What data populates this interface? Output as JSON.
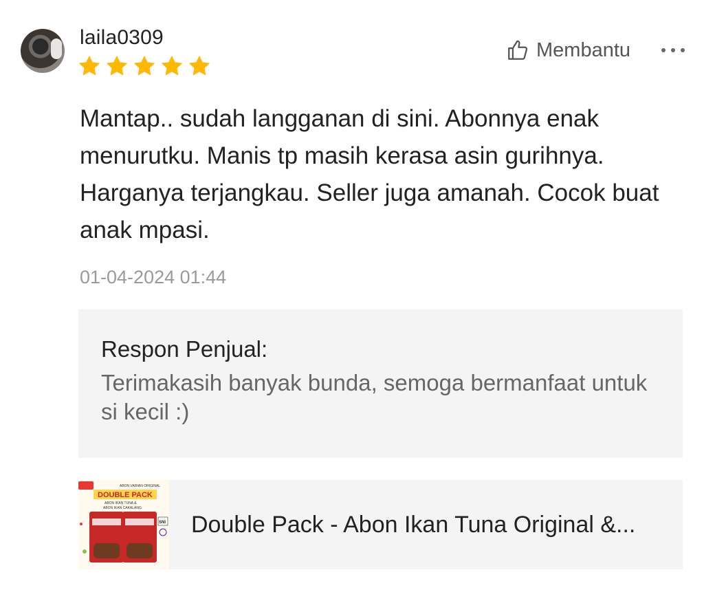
{
  "review": {
    "username": "laila0309",
    "rating": 5,
    "rating_max": 5,
    "text": "Mantap.. sudah langganan di sini. Abonnya enak menurutku. Manis tp masih kerasa asin gurihnya. Harganya terjangkau. Seller juga amanah. Cocok buat anak mpasi.",
    "timestamp": "01-04-2024 01:44"
  },
  "actions": {
    "helpful_label": "Membantu",
    "helpful_icon": "thumbs-up-icon",
    "more_icon": "more-horizontal-icon"
  },
  "seller_response": {
    "title": "Respon Penjual:",
    "text": "Terimakasih banyak bunda, semoga bermanfaat untuk si kecil :)"
  },
  "product": {
    "title": "Double Pack - Abon Ikan Tuna Original &...",
    "thumbnail": {
      "badge": "DOUBLE PACK",
      "top_label": "ABON VARIAN ORIGINAL",
      "subtitle_1": "ABON IKAN TUNA &",
      "subtitle_2": "ABON IKAN CAKALANG",
      "sni_label": "SNI"
    }
  },
  "colors": {
    "star": "#FFB800",
    "muted_text": "#9a9a9a",
    "panel_bg": "#f4f4f4"
  }
}
